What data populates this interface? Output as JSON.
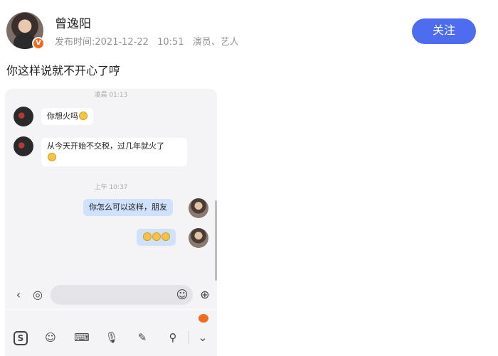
{
  "post": {
    "username": "曾逸阳",
    "publish_time": "发布时间:2021-12-22",
    "clock": "10:51",
    "role": "演员、艺人",
    "follow_label": "关注",
    "verified_badge": "V",
    "text": "你这样说就不开心了哼"
  },
  "chat": {
    "time1": "凌晨 01:13",
    "msg1": "你想火吗",
    "msg2": "从今天开始不交税，过几年就火了",
    "time2": "上午 10:37",
    "msg3": "你怎么可以这样，朋友"
  },
  "icons": {
    "back": "chevron-left-icon",
    "voice": "voice-icon",
    "emoji": "smiley-icon",
    "plus": "plus-icon",
    "keyboard": "keyboard-icon",
    "mic": "microphone-icon",
    "pen": "pen-icon",
    "search": "search-icon",
    "collapse": "chevron-down-icon"
  },
  "colors": {
    "follow_button": "#4d6cf0",
    "badge": "#f26b1d",
    "right_bubble": "#cfe1fb"
  }
}
